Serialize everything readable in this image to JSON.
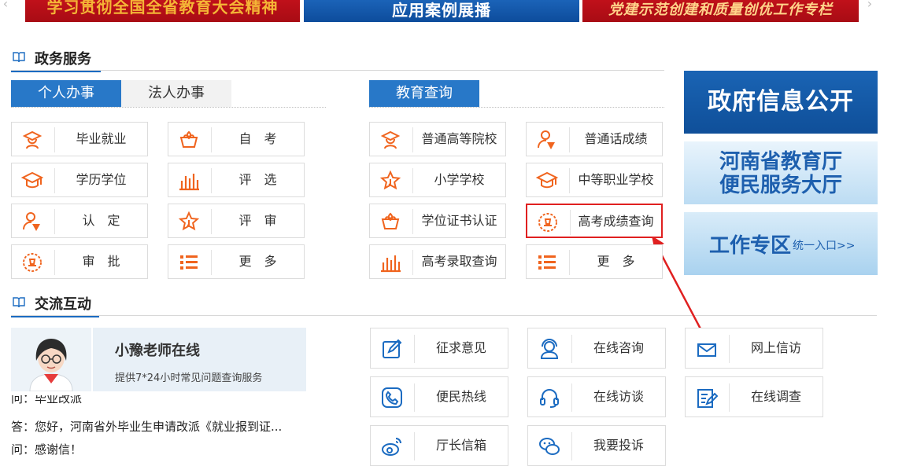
{
  "banners": [
    {
      "text": "学习贯彻全国全省教育大会精神"
    },
    {
      "text": "应用案例展播"
    },
    {
      "text": "党建示范创建和质量创优工作专栏"
    }
  ],
  "gov_services": {
    "title": "政务服务",
    "tabs_left": [
      {
        "label": "个人办事",
        "active": true
      },
      {
        "label": "法人办事",
        "active": false
      }
    ],
    "tab_edu": {
      "label": "教育查询"
    },
    "personal_items": [
      {
        "label": "毕业就业",
        "icon": "graduate-icon"
      },
      {
        "label": "自　考",
        "icon": "lotus-icon"
      },
      {
        "label": "学历学位",
        "icon": "mortarboard-icon"
      },
      {
        "label": "评　选",
        "icon": "bar-chart-icon"
      },
      {
        "label": "认　定",
        "icon": "user-check-icon"
      },
      {
        "label": "评　审",
        "icon": "star-icon"
      },
      {
        "label": "审　批",
        "icon": "stamp-icon"
      },
      {
        "label": "更　多",
        "icon": "list-icon"
      }
    ],
    "edu_items": [
      {
        "label": "普通高等院校",
        "icon": "graduate-icon"
      },
      {
        "label": "普通话成绩",
        "icon": "user-check-icon"
      },
      {
        "label": "小学学校",
        "icon": "star-icon"
      },
      {
        "label": "中等职业学校",
        "icon": "mortarboard-icon"
      },
      {
        "label": "学位证书认证",
        "icon": "lotus-icon"
      },
      {
        "label": "高考成绩查询",
        "icon": "stamp-icon",
        "highlighted": true
      },
      {
        "label": "高考录取查询",
        "icon": "bar-chart-icon"
      },
      {
        "label": "更　多",
        "icon": "list-icon"
      }
    ]
  },
  "right_banners": [
    {
      "text": "政府信息公开"
    },
    {
      "line1": "河南省教育厅",
      "line2": "便民服务大厅"
    },
    {
      "title": "工作专区",
      "sub": "统一入口>>"
    }
  ],
  "exchange": {
    "title": "交流互动",
    "teacher": {
      "name": "小豫老师在线",
      "desc": "提供7*24小时常见问题查询服务"
    },
    "qa": [
      "问：毕业改派",
      "答：您好，河南省外毕业生申请改派《就业报到证...",
      "问：感谢信！"
    ],
    "items": [
      {
        "label": "征求意见",
        "icon": "edit-icon"
      },
      {
        "label": "在线咨询",
        "icon": "support-icon"
      },
      {
        "label": "网上信访",
        "icon": "mail-icon"
      },
      {
        "label": "便民热线",
        "icon": "phone-icon"
      },
      {
        "label": "在线访谈",
        "icon": "headset-icon"
      },
      {
        "label": "在线调查",
        "icon": "survey-icon"
      },
      {
        "label": "厅长信箱",
        "icon": "weibo-icon"
      },
      {
        "label": "我要投诉",
        "icon": "wechat-icon"
      }
    ]
  },
  "colors": {
    "accent": "#2878c8",
    "icon_orange": "#f0641e",
    "icon_blue": "#1b6bc1",
    "highlight": "#e02020"
  }
}
